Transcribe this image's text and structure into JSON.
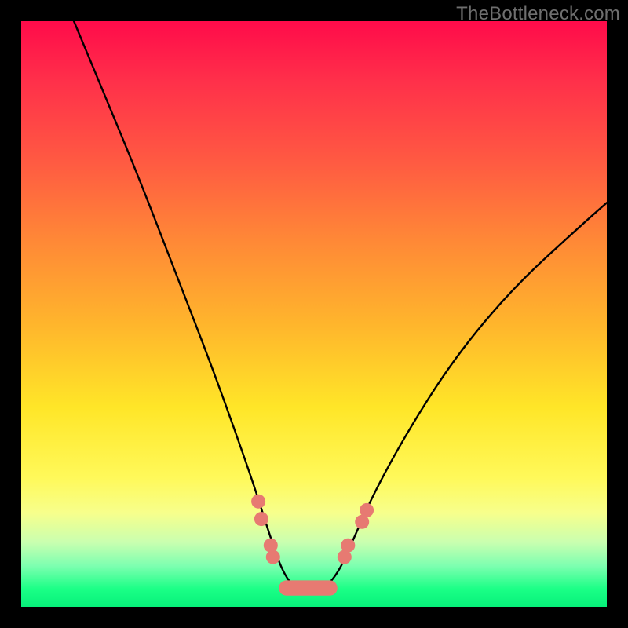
{
  "watermark": "TheBottleneck.com",
  "chart_data": {
    "type": "line",
    "title": "",
    "xlabel": "",
    "ylabel": "",
    "xlim": [
      0,
      100
    ],
    "ylim": [
      0,
      100
    ],
    "note": "V-shaped bottleneck curve over a red-to-green vertical gradient. x and y are normalized 0–100 of the plot area; y corresponds to gradient position (100=top/red, 0=bottom/green). Curve minimum near x≈47, y≈2.",
    "series": [
      {
        "name": "bottleneck-curve",
        "x": [
          9.0,
          14.0,
          20.0,
          26.0,
          32.0,
          36.0,
          40.0,
          42.5,
          45.0,
          48.0,
          51.0,
          54.0,
          56.5,
          60.0,
          66.0,
          74.0,
          84.0,
          96.0,
          100.0
        ],
        "y": [
          100.0,
          88.0,
          73.5,
          58.0,
          42.5,
          31.5,
          20.0,
          12.0,
          5.0,
          2.2,
          2.4,
          5.5,
          11.0,
          19.0,
          30.0,
          42.5,
          54.5,
          65.5,
          69.0
        ]
      }
    ],
    "markers": {
      "note": "Salmon dots clustered near the valley of the curve; approximate positions in same 0–100 plot coords.",
      "points": [
        {
          "x": 40.5,
          "y": 18.0
        },
        {
          "x": 41.0,
          "y": 15.0
        },
        {
          "x": 42.6,
          "y": 10.5
        },
        {
          "x": 43.0,
          "y": 8.5
        },
        {
          "x": 55.2,
          "y": 8.5
        },
        {
          "x": 55.8,
          "y": 10.5
        },
        {
          "x": 58.2,
          "y": 14.5
        },
        {
          "x": 59.0,
          "y": 16.5
        }
      ],
      "bar": {
        "x0": 44.0,
        "x1": 54.0,
        "y": 3.2,
        "h": 2.6
      }
    }
  }
}
